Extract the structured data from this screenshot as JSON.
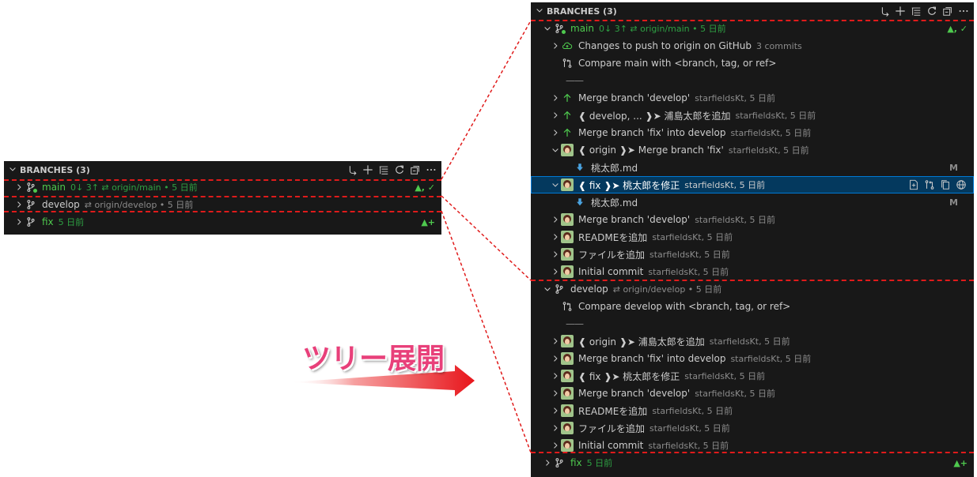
{
  "annotation": {
    "text": "ツリー展開"
  },
  "colors": {
    "accent_green": "#4ec94e",
    "selection": "#04395e",
    "dash": "#e01b1b",
    "arrow": "#e8151b"
  },
  "small": {
    "header": "BRANCHES (3)",
    "rows": [
      {
        "label": "main",
        "desc": "0↓ 3↑  ⇄  origin/main  •  5 日前",
        "badge": "▲, ✓"
      },
      {
        "label": "develop",
        "desc": "⇄  origin/develop  •  5 日前"
      },
      {
        "label": "fix",
        "desc": "5 日前",
        "badge": "▲+"
      }
    ]
  },
  "large": {
    "header": "BRANCHES (3)",
    "main": {
      "label": "main",
      "desc": "0↓ 3↑  ⇄  origin/main  •  5 日前",
      "badge": "▲, ✓"
    },
    "push": {
      "label": "Changes to push to origin on GitHub",
      "desc": "3 commits"
    },
    "compare_main": {
      "label": "Compare main with <branch, tag, or ref>"
    },
    "separator": "——",
    "main_commits": [
      {
        "label": "Merge branch 'develop'",
        "desc": "starfieldsKt, 5 日前"
      },
      {
        "label": "❰ develop, ... ❱➤  浦島太郎を追加",
        "desc": "starfieldsKt, 5 日前"
      },
      {
        "label": "Merge branch 'fix' into develop",
        "desc": "starfieldsKt, 5 日前"
      },
      {
        "label": "❰ origin ❱➤  Merge branch 'fix'",
        "desc": "starfieldsKt, 5 日前"
      }
    ],
    "file1": {
      "label": "桃太郎.md",
      "badge": "M"
    },
    "fix_commit": {
      "label": "❰ fix ❱➤  桃太郎を修正",
      "desc": "starfieldsKt, 5 日前"
    },
    "file2": {
      "label": "桃太郎.md",
      "badge": "M"
    },
    "main_tail": [
      {
        "label": "Merge branch 'develop'",
        "desc": "starfieldsKt, 5 日前"
      },
      {
        "label": "READMEを追加",
        "desc": "starfieldsKt, 5 日前"
      },
      {
        "label": "ファイルを追加",
        "desc": "starfieldsKt, 5 日前"
      },
      {
        "label": "Initial commit",
        "desc": "starfieldsKt, 5 日前"
      }
    ],
    "develop": {
      "label": "develop",
      "desc": "⇄  origin/develop  •  5 日前"
    },
    "compare_develop": {
      "label": "Compare develop with <branch, tag, or ref>"
    },
    "develop_commits": [
      {
        "label": "❰ origin ❱➤  浦島太郎を追加",
        "desc": "starfieldsKt, 5 日前"
      },
      {
        "label": "Merge branch 'fix' into develop",
        "desc": "starfieldsKt, 5 日前"
      },
      {
        "label": "❰ fix ❱➤  桃太郎を修正",
        "desc": "starfieldsKt, 5 日前"
      },
      {
        "label": "Merge branch 'develop'",
        "desc": "starfieldsKt, 5 日前"
      },
      {
        "label": "READMEを追加",
        "desc": "starfieldsKt, 5 日前"
      },
      {
        "label": "ファイルを追加",
        "desc": "starfieldsKt, 5 日前"
      },
      {
        "label": "Initial commit",
        "desc": "starfieldsKt, 5 日前"
      }
    ],
    "fix": {
      "label": "fix",
      "desc": "5 日前",
      "badge": "▲+"
    }
  }
}
